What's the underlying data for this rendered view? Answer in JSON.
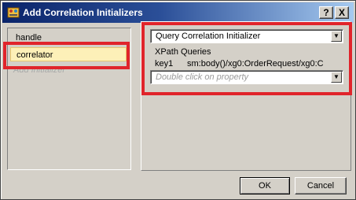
{
  "window": {
    "title": "Add Correlation Initializers",
    "help_label": "?",
    "close_label": "X"
  },
  "left_list": {
    "items": [
      {
        "label": "handle"
      },
      {
        "label": "correlator",
        "selected": true
      }
    ],
    "add_placeholder": "Add Initializer"
  },
  "right_panel": {
    "type_dropdown": "Query Correlation Initializer",
    "xpath_label": "XPath Queries",
    "xpath_key": "key1",
    "xpath_value": "sm:body()/xg0:OrderRequest/xg0:C",
    "property_placeholder": "Double click on property"
  },
  "buttons": {
    "ok": "OK",
    "cancel": "Cancel"
  },
  "colors": {
    "title_bar": "#0a246a",
    "highlight": "#e0242b",
    "selected_item": "#fdf0b8",
    "dialog_bg": "#d4d0c8"
  }
}
